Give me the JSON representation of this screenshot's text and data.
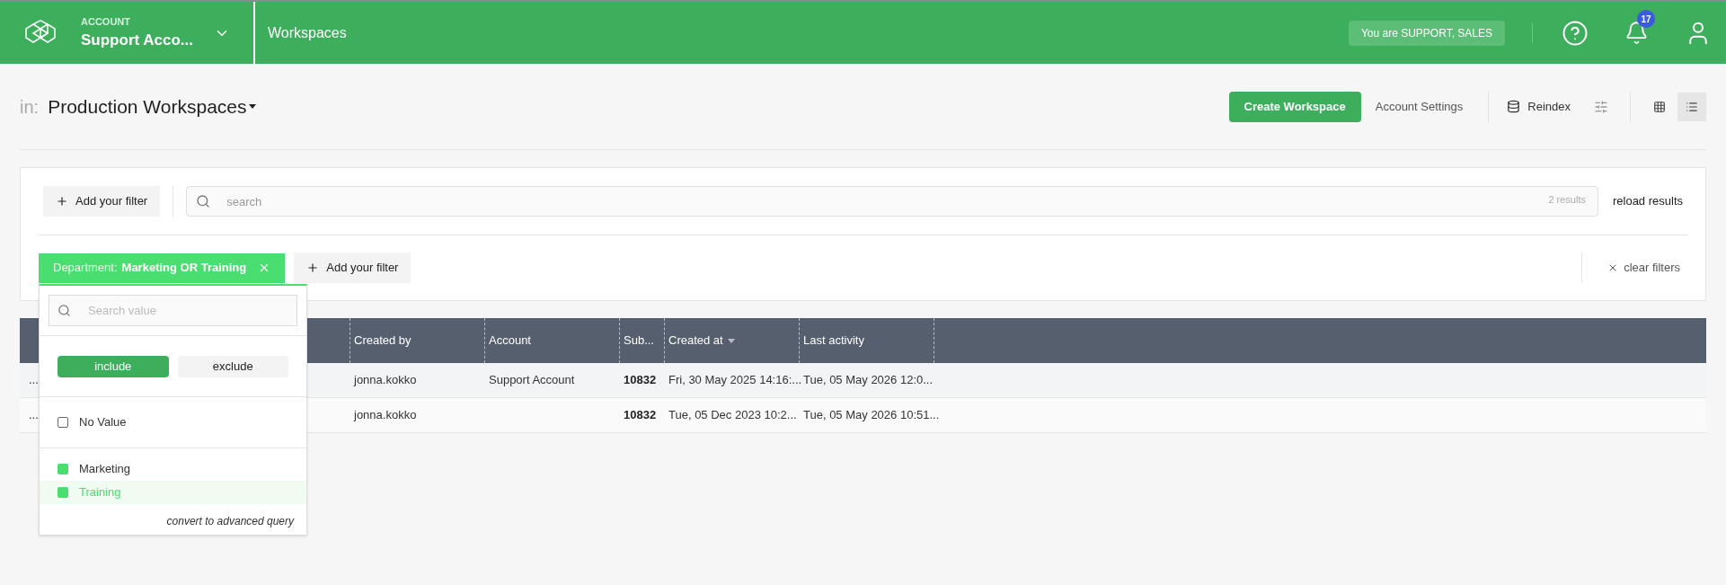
{
  "header": {
    "account_label": "ACCOUNT",
    "account_name": "Support Acco...",
    "section_title": "Workspaces",
    "role_badge": "You are SUPPORT, SALES",
    "notification_count": "17"
  },
  "toolbar": {
    "in_label": "in:",
    "workspace_set": "Production Workspaces",
    "create_button": "Create Workspace",
    "settings_button": "Account Settings",
    "reindex_button": "Reindex",
    "views": [
      {
        "kind": "grid",
        "selected": false
      },
      {
        "kind": "list",
        "selected": true
      }
    ]
  },
  "filters": {
    "add_filter": "Add your filter",
    "search_placeholder": "search",
    "result_count": "2 results",
    "reload": "reload results",
    "active_filters": [
      {
        "field": "Department:",
        "value": "Marketing OR Training"
      }
    ],
    "add_filter_2": "Add your filter",
    "clear_filters": "clear filters"
  },
  "popover": {
    "search_placeholder": "Search value",
    "modes": [
      {
        "label": "include",
        "selected": true
      },
      {
        "label": "exclude",
        "selected": false
      }
    ],
    "no_value": {
      "label": "No Value",
      "checked": false
    },
    "options": [
      {
        "label": "Marketing",
        "checked": true,
        "highlighted": false
      },
      {
        "label": "Training",
        "checked": true,
        "highlighted": true
      }
    ],
    "advanced_link": "convert to advanced query"
  },
  "table": {
    "columns": [
      {
        "label": "Created by",
        "sorted": false
      },
      {
        "label": "Account",
        "sorted": false
      },
      {
        "label": "Sub...",
        "sorted": false
      },
      {
        "label": "Created at",
        "sorted": true
      },
      {
        "label": "Last activity",
        "sorted": false
      }
    ],
    "rows": [
      {
        "lead": "...",
        "cells": [
          "jonna.kokko",
          "Support Account",
          "10832",
          "Fri, 30 May 2025 14:16:...",
          "Tue, 05 May 2026 12:0..."
        ]
      },
      {
        "lead": "...",
        "cells": [
          "jonna.kokko",
          "",
          "10832",
          "Tue, 05 Dec 2023 10:2...",
          "Tue, 05 May 2026 10:51..."
        ]
      }
    ]
  }
}
